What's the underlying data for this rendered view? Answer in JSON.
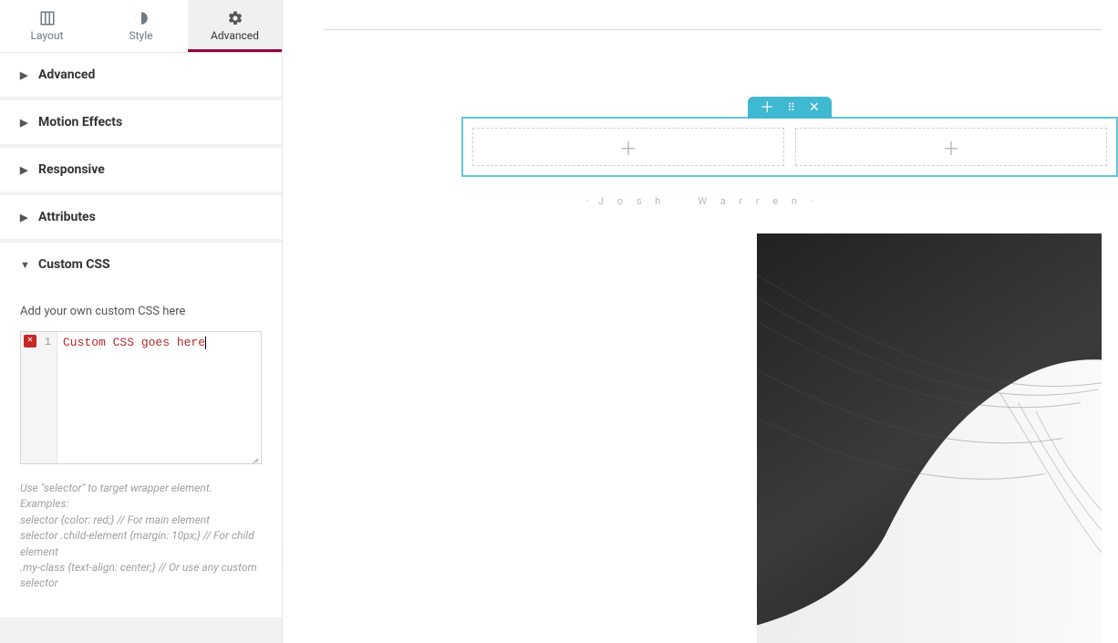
{
  "tabs": {
    "layout": "Layout",
    "style": "Style",
    "advanced": "Advanced"
  },
  "sections": {
    "advanced": "Advanced",
    "motion_effects": "Motion Effects",
    "responsive": "Responsive",
    "attributes": "Attributes",
    "custom_css": "Custom CSS"
  },
  "custom_css": {
    "field_label": "Add your own custom CSS here",
    "line_no": "1",
    "code": "Custom CSS goes here",
    "hint_line1": "Use \"selector\" to target wrapper element. Examples:",
    "hint_line2": "selector {color: red;} // For main element",
    "hint_line3": "selector .child-element {margin: 10px;} // For child element",
    "hint_line4": ".my-class {text-align: center;} // Or use any custom selector"
  },
  "preview": {
    "caption_first": "J o s h",
    "caption_last": "W a r r e n"
  },
  "icons": {
    "layout": "layout-icon",
    "style": "style-icon",
    "advanced": "gear-icon"
  }
}
